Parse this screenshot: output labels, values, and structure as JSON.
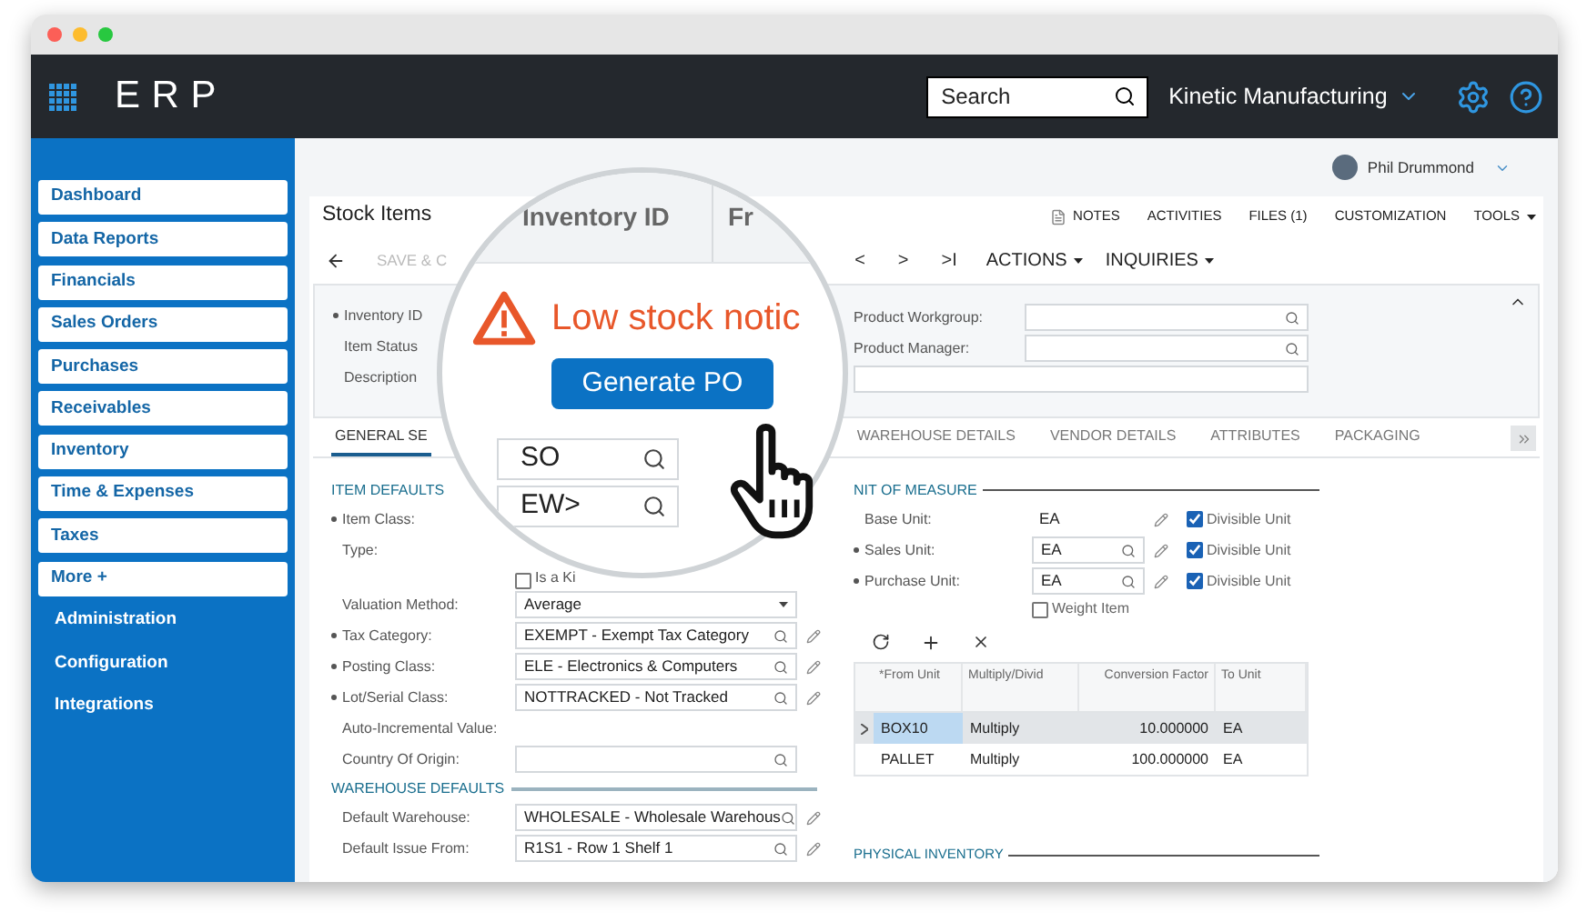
{
  "topbar": {
    "logo": "ERP",
    "search": {
      "placeholder": "Search"
    },
    "company": "Kinetic Manufacturing"
  },
  "sidebar": {
    "items": [
      {
        "label": "Dashboard",
        "kind": "tile"
      },
      {
        "label": "Data Reports",
        "kind": "tile"
      },
      {
        "label": "Financials",
        "kind": "tile"
      },
      {
        "label": "Sales Orders",
        "kind": "tile"
      },
      {
        "label": "Purchases",
        "kind": "tile"
      },
      {
        "label": "Receivables",
        "kind": "tile"
      },
      {
        "label": "Inventory",
        "kind": "tile"
      },
      {
        "label": "Time & Expenses",
        "kind": "tile"
      },
      {
        "label": "Taxes",
        "kind": "tile"
      },
      {
        "label": "More +",
        "kind": "tile"
      },
      {
        "label": "Administration",
        "kind": "link"
      },
      {
        "label": "Configuration",
        "kind": "link"
      },
      {
        "label": "Integrations",
        "kind": "link"
      }
    ]
  },
  "user": {
    "name": "Phil Drummond"
  },
  "page": {
    "title": "Stock Items",
    "header_links": [
      {
        "label": "NOTES",
        "kind": "note"
      },
      {
        "label": "ACTIVITIES",
        "kind": "plain"
      },
      {
        "label": "FILES (1)",
        "kind": "plain"
      },
      {
        "label": "CUSTOMIZATION",
        "kind": "plain"
      },
      {
        "label": "TOOLS",
        "kind": "menu"
      }
    ]
  },
  "toolbar": {
    "save": "SAVE & C",
    "nav": [
      "<",
      ">",
      ">I"
    ],
    "menus": [
      "ACTIONS",
      "INQUIRIES"
    ]
  },
  "summary": {
    "left": [
      {
        "label": "Inventory ID",
        "required": true
      },
      {
        "label": "Item Status",
        "required": false
      },
      {
        "label": "Description",
        "required": false
      }
    ],
    "right": [
      {
        "label": "Product Workgroup:",
        "kind": "lookup"
      },
      {
        "label": "Product Manager:",
        "kind": "lookup"
      },
      {
        "kind": "wide"
      }
    ]
  },
  "tabs": [
    {
      "label": "GENERAL SE",
      "selected": true
    },
    {
      "label": "WAREHOUSE DETAILS",
      "selected": false
    },
    {
      "label": "VENDOR DETAILS",
      "selected": false
    },
    {
      "label": "ATTRIBUTES",
      "selected": false
    },
    {
      "label": "PACKAGING",
      "selected": false
    }
  ],
  "left_sections": [
    {
      "title": "ITEM DEFAULTS",
      "rows": [
        {
          "kind": "covered",
          "label": "Item Class:",
          "required": true
        },
        {
          "kind": "covered",
          "label": "Type:",
          "required": false
        },
        {
          "kind": "checkbox",
          "label": "Is a Ki",
          "checked": false
        },
        {
          "kind": "select",
          "label": "Valuation Method:",
          "required": false,
          "value": "Average"
        },
        {
          "kind": "lookup",
          "label": "Tax Category:",
          "required": true,
          "value": "EXEMPT - Exempt Tax Category",
          "edit": true
        },
        {
          "kind": "lookup",
          "label": "Posting Class:",
          "required": true,
          "value": "ELE - Electronics & Computers",
          "edit": true
        },
        {
          "kind": "lookup",
          "label": "Lot/Serial Class:",
          "required": true,
          "value": "NOTTRACKED - Not Tracked",
          "edit": true
        },
        {
          "kind": "label",
          "label": "Auto-Incremental Value:",
          "required": false
        },
        {
          "kind": "lookup",
          "label": "Country Of Origin:",
          "required": false,
          "edit": false
        }
      ]
    },
    {
      "title": "WAREHOUSE DEFAULTS",
      "rows": [
        {
          "kind": "lookup",
          "label": "Default Warehouse:",
          "required": false,
          "value": "WHOLESALE - Wholesale Warehous",
          "edit": true
        },
        {
          "kind": "lookup",
          "label": "Default Issue From:",
          "required": false,
          "value": "R1S1 - Row 1 Shelf 1",
          "edit": true
        }
      ]
    }
  ],
  "uom": {
    "title": "NIT OF MEASURE",
    "rows": [
      {
        "label": "Base Unit:",
        "required": false,
        "value": "EA",
        "lookup": false,
        "checkbox": {
          "label": "Divisible Unit",
          "checked": true
        }
      },
      {
        "label": "Sales Unit:",
        "required": true,
        "value": "EA",
        "lookup": true,
        "checkbox": {
          "label": "Divisible Unit",
          "checked": true
        }
      },
      {
        "label": "Purchase Unit:",
        "required": true,
        "value": "EA",
        "lookup": true,
        "checkbox": {
          "label": "Divisible Unit",
          "checked": true
        }
      }
    ],
    "weight": {
      "label": "Weight Item",
      "checked": false
    },
    "table": {
      "columns": [
        "*From Unit",
        "Multiply/Divid",
        "Conversion Factor",
        "To Unit"
      ],
      "rows": [
        {
          "cells": [
            "BOX10",
            "Multiply",
            "10.000000",
            "EA"
          ],
          "selected": true
        },
        {
          "cells": [
            "PALLET",
            "Multiply",
            "100.000000",
            "EA"
          ],
          "selected": false
        }
      ]
    }
  },
  "next_section": "PHYSICAL INVENTORY",
  "magnifier": {
    "header": [
      "Inventory ID",
      "Fr"
    ],
    "notice": "Low stock notic",
    "button": "Generate PO",
    "fields": [
      "SO",
      "EW>"
    ]
  }
}
